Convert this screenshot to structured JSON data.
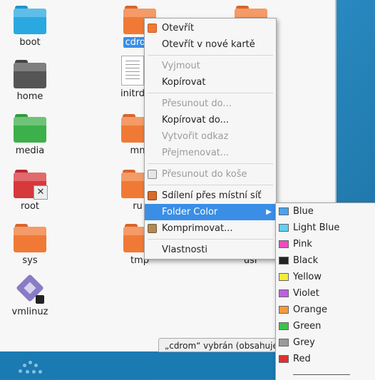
{
  "desktop": {
    "accent": "#2a8bc3"
  },
  "files": [
    {
      "name": "boot",
      "color": "#29a9e0",
      "icon": "folder-icon"
    },
    {
      "name": "cdrom",
      "color": "#f07a35",
      "icon": "folder-icon"
    },
    {
      "name": "",
      "color": "#f07a35",
      "icon": "folder-icon"
    },
    {
      "name": "home",
      "color": "#555555",
      "icon": "folder-icon"
    },
    {
      "name": "initrd",
      "color": "",
      "icon": "document-icon"
    },
    {
      "name": "media",
      "color": "#3cb04a",
      "icon": "folder-icon"
    },
    {
      "name": "mn",
      "color": "#f07a35",
      "icon": "folder-icon"
    },
    {
      "name": "root",
      "color": "#d6383c",
      "icon": "folder-icon"
    },
    {
      "name": "ru",
      "color": "#f07a35",
      "icon": "folder-icon"
    },
    {
      "name": "sys",
      "color": "#f07a35",
      "icon": "folder-icon"
    },
    {
      "name": "tmp",
      "color": "#f07a35",
      "icon": "folder-icon"
    },
    {
      "name": "usr",
      "color": "#f07a35",
      "icon": "folder-icon"
    },
    {
      "name": "vmlinuz",
      "color": "",
      "icon": "executable-icon"
    }
  ],
  "statusbar": {
    "text": "„cdrom“ vybrán  (obsahuje"
  },
  "context_menu": {
    "items": [
      {
        "label": "Otevřít",
        "enabled": true,
        "icon": "folder-open-icon"
      },
      {
        "label": "Otevřít v nové kartě",
        "enabled": true
      },
      {
        "label": "Vyjmout",
        "enabled": false
      },
      {
        "label": "Kopírovat",
        "enabled": true
      },
      {
        "label": "Přesunout do...",
        "enabled": false
      },
      {
        "label": "Kopírovat do...",
        "enabled": true
      },
      {
        "label": "Vytvořit odkaz",
        "enabled": false
      },
      {
        "label": "Přejmenovat...",
        "enabled": false
      },
      {
        "label": "Přesunout do koše",
        "enabled": false,
        "icon": "trash-icon"
      },
      {
        "label": "Sdílení přes místní síť",
        "enabled": true,
        "icon": "share-icon"
      },
      {
        "label": "Folder Color",
        "enabled": true,
        "highlighted": true
      },
      {
        "label": "Komprimovat...",
        "enabled": true,
        "icon": "archive-icon"
      },
      {
        "label": "Vlastnosti",
        "enabled": true
      }
    ]
  },
  "folder_color_menu": {
    "items": [
      {
        "label": "Blue",
        "color": "#4aa3f0"
      },
      {
        "label": "Light Blue",
        "color": "#5fd0f5"
      },
      {
        "label": "Pink",
        "color": "#f04ac0"
      },
      {
        "label": "Black",
        "color": "#222222"
      },
      {
        "label": "Yellow",
        "color": "#f5ec3a"
      },
      {
        "label": "Violet",
        "color": "#c060e0"
      },
      {
        "label": "Orange",
        "color": "#f59a3a"
      },
      {
        "label": "Green",
        "color": "#3cc24a"
      },
      {
        "label": "Grey",
        "color": "#9a9a9a"
      },
      {
        "label": "Red",
        "color": "#e03030"
      }
    ]
  }
}
